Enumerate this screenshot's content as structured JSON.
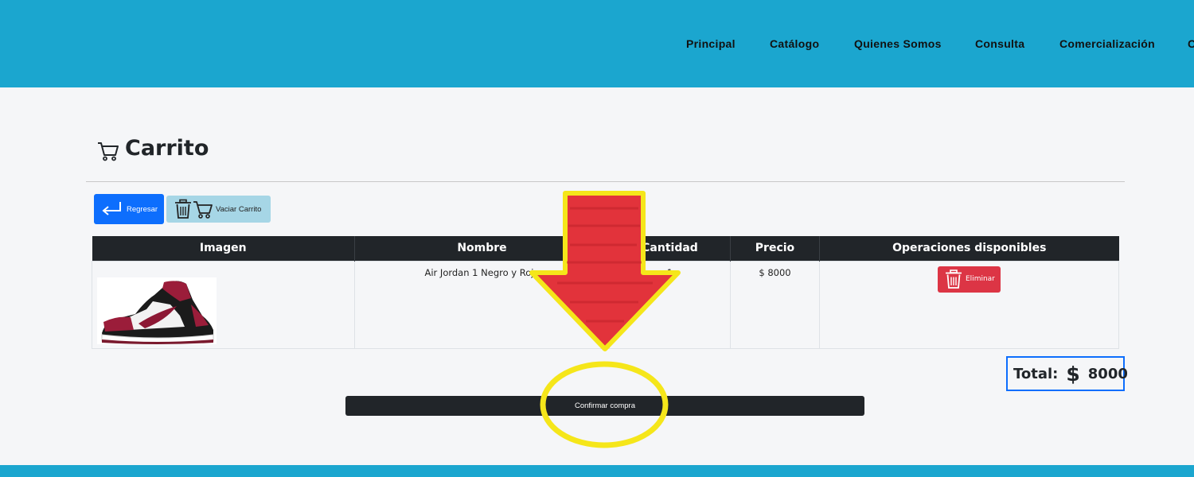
{
  "nav": {
    "items": [
      {
        "label": "Principal"
      },
      {
        "label": "Catálogo"
      },
      {
        "label": "Quienes Somos"
      },
      {
        "label": "Consulta"
      },
      {
        "label": "Comercialización"
      },
      {
        "label": "C"
      }
    ]
  },
  "page": {
    "title": "Carrito"
  },
  "actions": {
    "back_label": "Regresar",
    "empty_cart_label": "Vaciar Carrito"
  },
  "table": {
    "headers": [
      "Imagen",
      "Nombre",
      "Cantidad",
      "Precio",
      "Operaciones disponibles"
    ],
    "rows": [
      {
        "name": "Air Jordan 1 Negro y Rojo",
        "quantity": "1",
        "price": "$ 8000",
        "delete_label": "Eliminar"
      }
    ]
  },
  "summary": {
    "total_label": "Total:",
    "currency_symbol": "$",
    "total_value": "8000"
  },
  "confirm": {
    "label": "Confirmar compra"
  },
  "colors": {
    "header_bg": "#1ba6cf",
    "primary": "#0d6efd",
    "danger": "#dc3545",
    "dark": "#212529",
    "info_light": "#a6d6e6",
    "annotation_arrow": "#e2333b",
    "annotation_outline": "#f5e61a"
  },
  "icons": [
    "return-arrow-icon",
    "trash-icon",
    "cart-icon"
  ]
}
